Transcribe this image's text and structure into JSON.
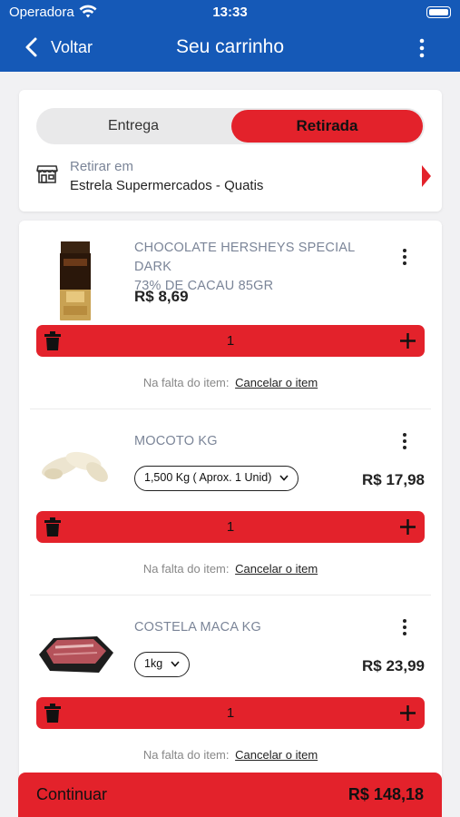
{
  "status_bar": {
    "carrier": "Operadora",
    "time": "13:33"
  },
  "nav": {
    "back_label": "Voltar",
    "title": "Seu carrinho"
  },
  "delivery_toggle": {
    "option_delivery": "Entrega",
    "option_pickup": "Retirada",
    "selected": "Retirada"
  },
  "pickup": {
    "label": "Retirar em",
    "store": "Estrela Supermercados - Quatis"
  },
  "items": [
    {
      "name_line1": "CHOCOLATE HERSHEYS SPECIAL DARK",
      "name_line2": "73% DE CACAU 85GR",
      "price": "R$ 8,69",
      "quantity": "1",
      "fallback_label": "Na falta do item:",
      "fallback_action": "Cancelar o item"
    },
    {
      "name_line1": "MOCOTO KG",
      "weight_option": "1,500 Kg ( Aprox. 1 Unid)",
      "price": "R$ 17,98",
      "quantity": "1",
      "fallback_label": "Na falta do item:",
      "fallback_action": "Cancelar o item"
    },
    {
      "name_line1": "COSTELA MACA KG",
      "weight_option": "1kg",
      "price": "R$ 23,99",
      "quantity": "1",
      "fallback_label": "Na falta do item:",
      "fallback_action": "Cancelar o item"
    }
  ],
  "footer": {
    "continue_label": "Continuar",
    "total": "R$ 148,18"
  },
  "colors": {
    "header_blue": "#1559b7",
    "accent_red": "#e3222b",
    "muted_text": "#7b8598"
  },
  "icons": [
    "wifi-icon",
    "battery-icon",
    "back-chevron-icon",
    "more-vertical-icon",
    "store-icon",
    "arrow-right-icon",
    "trash-icon",
    "plus-icon",
    "chevron-down-icon"
  ]
}
